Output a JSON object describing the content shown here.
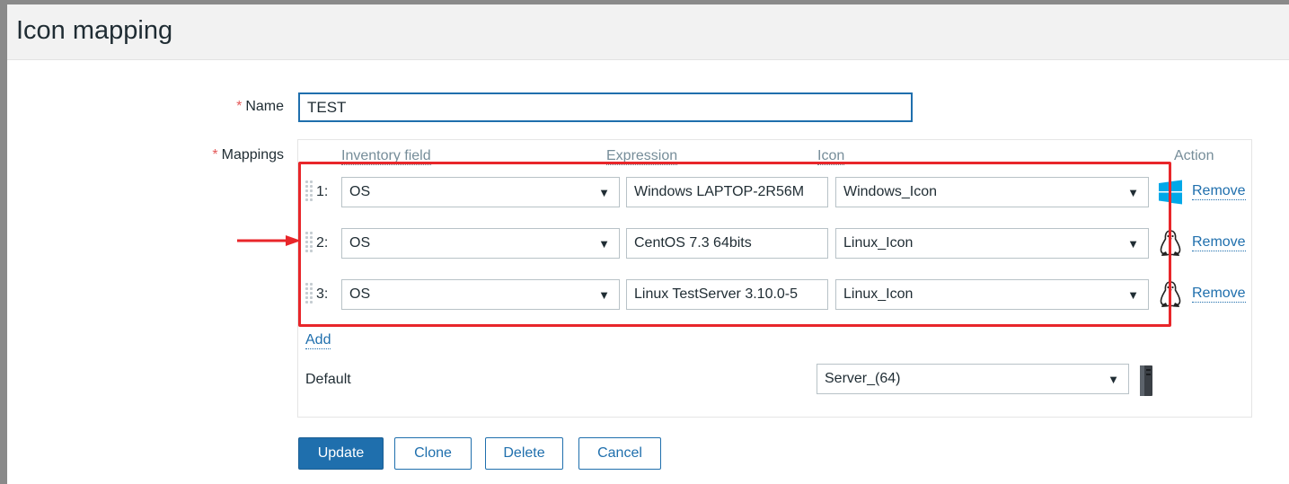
{
  "page": {
    "title": "Icon mapping"
  },
  "form": {
    "required_marker": "*",
    "name_label": "Name",
    "name_value": "TEST",
    "mappings_label": "Mappings"
  },
  "mappings": {
    "headers": {
      "inventory_field": "Inventory field",
      "expression": "Expression",
      "icon": "Icon",
      "action": "Action"
    },
    "rows": [
      {
        "num": "1:",
        "field": "OS",
        "expression": "Windows LAPTOP-2R56M",
        "icon": "Windows_Icon",
        "icon_type": "windows-icon",
        "action": "Remove"
      },
      {
        "num": "2:",
        "field": "OS",
        "expression": "CentOS 7.3 64bits",
        "icon": "Linux_Icon",
        "icon_type": "linux-penguin-icon",
        "action": "Remove"
      },
      {
        "num": "3:",
        "field": "OS",
        "expression": "Linux TestServer 3.10.0-5",
        "icon": "Linux_Icon",
        "icon_type": "linux-penguin-icon",
        "action": "Remove"
      }
    ],
    "add_label": "Add",
    "default_label": "Default",
    "default_icon": "Server_(64)",
    "default_icon_type": "server-icon"
  },
  "buttons": {
    "update": "Update",
    "clone": "Clone",
    "delete": "Delete",
    "cancel": "Cancel"
  },
  "colors": {
    "accent": "#1f6fad",
    "highlight": "#e8262a",
    "required": "#e45959",
    "header_bg": "#f2f2f2"
  }
}
